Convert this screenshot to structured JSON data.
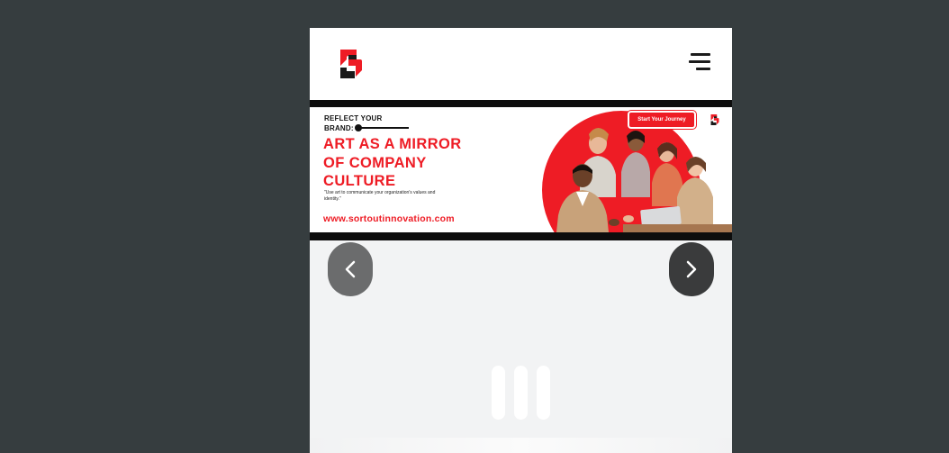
{
  "header": {
    "logo_icon": "sortout-logo-icon",
    "menu_icon": "hamburger-menu-icon"
  },
  "banner": {
    "kicker": "REFLECT YOUR\nBRAND:",
    "headline": "ART AS A MIRROR\nOF COMPANY\nCULTURE",
    "quote": "\"Use art to communicate your organization's values and identity.\"",
    "website": "www.sortoutinnovation.com",
    "cta_label": "Start Your Journey",
    "accent_color": "#ee1c25"
  },
  "carousel": {
    "prev_icon": "chevron-left-icon",
    "next_icon": "chevron-right-icon",
    "loader_icon": "loading-bars-icon"
  },
  "colors": {
    "page_background": "#363d3f",
    "content_background": "#f2f3f4",
    "brand_red": "#ee1c25"
  }
}
